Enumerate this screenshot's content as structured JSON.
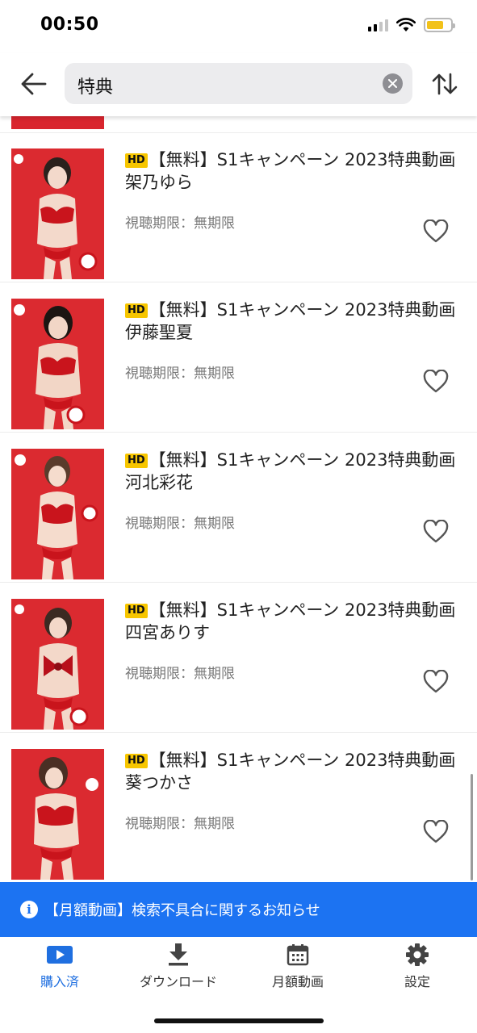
{
  "status_bar": {
    "time": "00:50"
  },
  "search": {
    "query": "特典"
  },
  "items": [
    {
      "hd": "HD",
      "title": "【無料】S1キャンペーン 2023特典動画 架乃ゆら",
      "period": "視聴期限：無期限"
    },
    {
      "hd": "HD",
      "title": "【無料】S1キャンペーン 2023特典動画 伊藤聖夏",
      "period": "視聴期限：無期限"
    },
    {
      "hd": "HD",
      "title": "【無料】S1キャンペーン 2023特典動画 河北彩花",
      "period": "視聴期限：無期限"
    },
    {
      "hd": "HD",
      "title": "【無料】S1キャンペーン 2023特典動画 四宮ありす",
      "period": "視聴期限：無期限"
    },
    {
      "hd": "HD",
      "title": "【無料】S1キャンペーン 2023特典動画 葵つかさ",
      "period": "視聴期限：無期限"
    }
  ],
  "notice": {
    "text": "【月額動画】検索不具合に関するお知らせ"
  },
  "tabs": [
    {
      "label": "購入済",
      "icon": "play-icon",
      "active": true
    },
    {
      "label": "ダウンロード",
      "icon": "download-icon",
      "active": false
    },
    {
      "label": "月額動画",
      "icon": "calendar-icon",
      "active": false
    },
    {
      "label": "設定",
      "icon": "gear-icon",
      "active": false
    }
  ],
  "colors": {
    "accent": "#1c73f2",
    "hd_badge": "#f7c600",
    "thumbnail": "#db2a30"
  }
}
